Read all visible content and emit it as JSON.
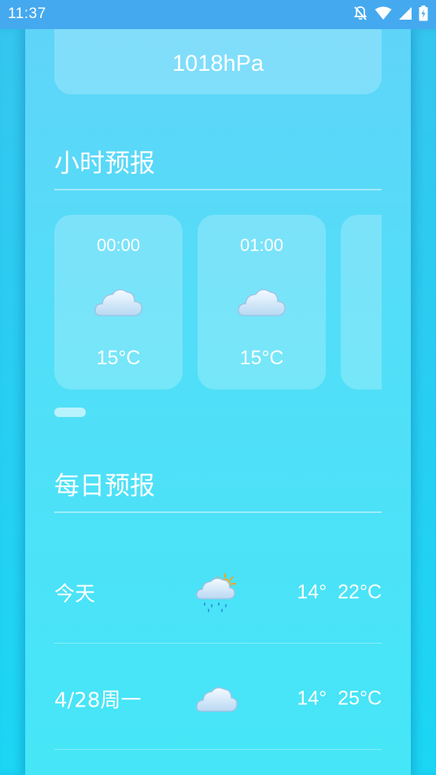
{
  "status_bar": {
    "time": "11:37",
    "icons": [
      "notifications-off-icon",
      "wifi-icon",
      "signal-icon",
      "battery-charging-icon"
    ]
  },
  "pressure": {
    "value": "1018hPa"
  },
  "hourly": {
    "title": "小时预报",
    "items": [
      {
        "time": "00:00",
        "icon": "cloud-icon",
        "temp": "15°C"
      },
      {
        "time": "01:00",
        "icon": "cloud-icon",
        "temp": "15°C"
      },
      {
        "time": "",
        "icon": "",
        "temp": ""
      }
    ]
  },
  "daily": {
    "title": "每日预报",
    "items": [
      {
        "day": "今天",
        "icon": "rain-sun-cloud-icon",
        "low": "14°",
        "high": "22°C"
      },
      {
        "day": "4/28周一",
        "icon": "cloud-icon",
        "low": "14°",
        "high": "25°C"
      }
    ]
  },
  "colors": {
    "status_bar": "#45a9ef",
    "panel_top": "#5fd4f9",
    "panel_bottom": "#45e6f7",
    "side_bg": "#1bd3f2"
  }
}
